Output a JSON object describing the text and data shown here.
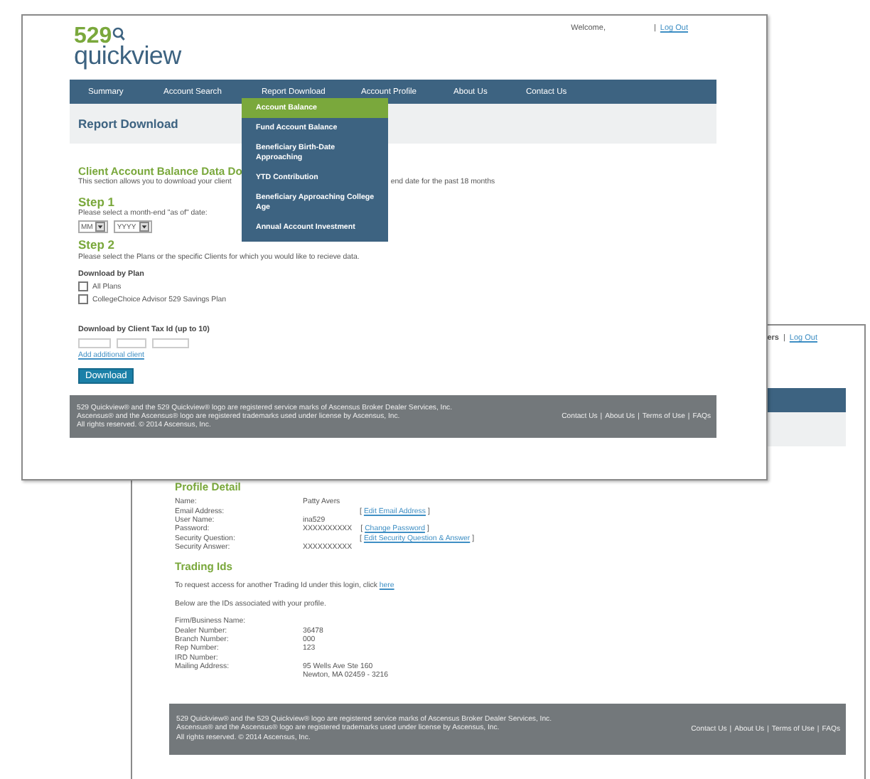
{
  "back_window": {
    "header": {
      "welcome_fragment": "ers",
      "separator": "|",
      "logout": "Log Out"
    },
    "profile": {
      "title": "Profile Detail",
      "rows": [
        {
          "label": "Name:",
          "value": "Patty Avers"
        },
        {
          "label": "Email Address:",
          "link": {
            "open": "[",
            "text": "Edit Email Address",
            "close": "]"
          }
        },
        {
          "label": "User Name:",
          "value": "ina529"
        },
        {
          "label": "Password:",
          "value": "XXXXXXXXXX",
          "link": {
            "open": "[",
            "text": "Change Password",
            "close": "]"
          }
        },
        {
          "label": "Security Question:",
          "link": {
            "open": "[",
            "text": "Edit Security Question & Answer",
            "close": "]"
          }
        },
        {
          "label": "Security Answer:",
          "value": "XXXXXXXXXX"
        }
      ]
    },
    "trading": {
      "title": "Trading Ids",
      "request_text": "To request access for another Trading Id under this login, click",
      "request_link": "here",
      "below_text": "Below are the IDs associated with your profile.",
      "rows": [
        {
          "label": "Firm/Business Name:"
        },
        {
          "label": "Dealer Number:",
          "value": [
            "36478"
          ]
        },
        {
          "label": "Branch Number:",
          "value": [
            "000"
          ]
        },
        {
          "label": "Rep Number:",
          "value": [
            "123"
          ]
        },
        {
          "label": "IRD Number:"
        },
        {
          "label": "Mailing Address:",
          "value": [
            "95 Wells Ave Ste 160",
            "Newton, MA 02459 - 3216"
          ]
        }
      ]
    },
    "footer": {
      "lines": [
        "529 Quickview® and the 529 Quickview® logo are registered service marks of Ascensus Broker Dealer Services, Inc.",
        "Ascensus® and the Ascensus® logo are registered trademarks used under license by Ascensus, Inc.",
        "All rights reserved. © 2014 Ascensus, Inc."
      ],
      "links": [
        "Contact Us",
        "About Us",
        "Terms of Use",
        "FAQs"
      ],
      "separator": "|"
    }
  },
  "front_window": {
    "header": {
      "welcome": "Welcome,",
      "separator": "|",
      "logout": "Log Out"
    },
    "logo": {
      "number": "529",
      "word": "quickview"
    },
    "nav": [
      {
        "label": "Summary"
      },
      {
        "label": "Account Search"
      },
      {
        "label": "Report Download",
        "menu": [
          {
            "label": "Account Balance",
            "selected": true
          },
          {
            "label": "Fund Account Balance",
            "selected": false
          },
          {
            "label": "Beneficiary Birth-Date Approaching",
            "selected": false
          },
          {
            "label": "YTD Contribution",
            "selected": false
          },
          {
            "label": "Beneficiary Approaching College Age",
            "selected": false
          },
          {
            "label": "Annual Account Investment",
            "selected": false
          }
        ]
      },
      {
        "label": "Account Profile"
      },
      {
        "label": "About Us"
      },
      {
        "label": "Contact Us"
      }
    ],
    "page_title": "Report Download",
    "section": {
      "title": "Client Account Balance Data Do",
      "description_start": "This section allows you to download your client",
      "description_end": "end date for the past 18 months"
    },
    "step1": {
      "title": "Step 1",
      "text": "Please select a month-end \"as of\" date:",
      "selects": [
        {
          "value": "MM"
        },
        {
          "value": "YYYY"
        }
      ]
    },
    "step2": {
      "title": "Step 2",
      "text": "Please select the Plans or the specific Clients for which you would like to recieve data."
    },
    "by_plan": {
      "title": "Download by Plan",
      "options": [
        {
          "label": "All Plans",
          "checked": false
        },
        {
          "label": "CollegeChoice Advisor 529 Savings Plan",
          "checked": false
        }
      ]
    },
    "by_client": {
      "title": "Download by Client Tax Id (up to 10)",
      "add_link": "Add additional client"
    },
    "download_button": "Download",
    "footer": {
      "lines": [
        "529 Quickview® and the 529 Quickview® logo are registered service marks of Ascensus Broker Dealer Services, Inc.",
        "Ascensus® and the Ascensus® logo are registered trademarks used under license by Ascensus, Inc.",
        "All rights reserved. © 2014 Ascensus, Inc."
      ],
      "links": [
        "Contact Us",
        "About Us",
        "Terms of Use",
        "FAQs"
      ],
      "separator": "|"
    }
  }
}
